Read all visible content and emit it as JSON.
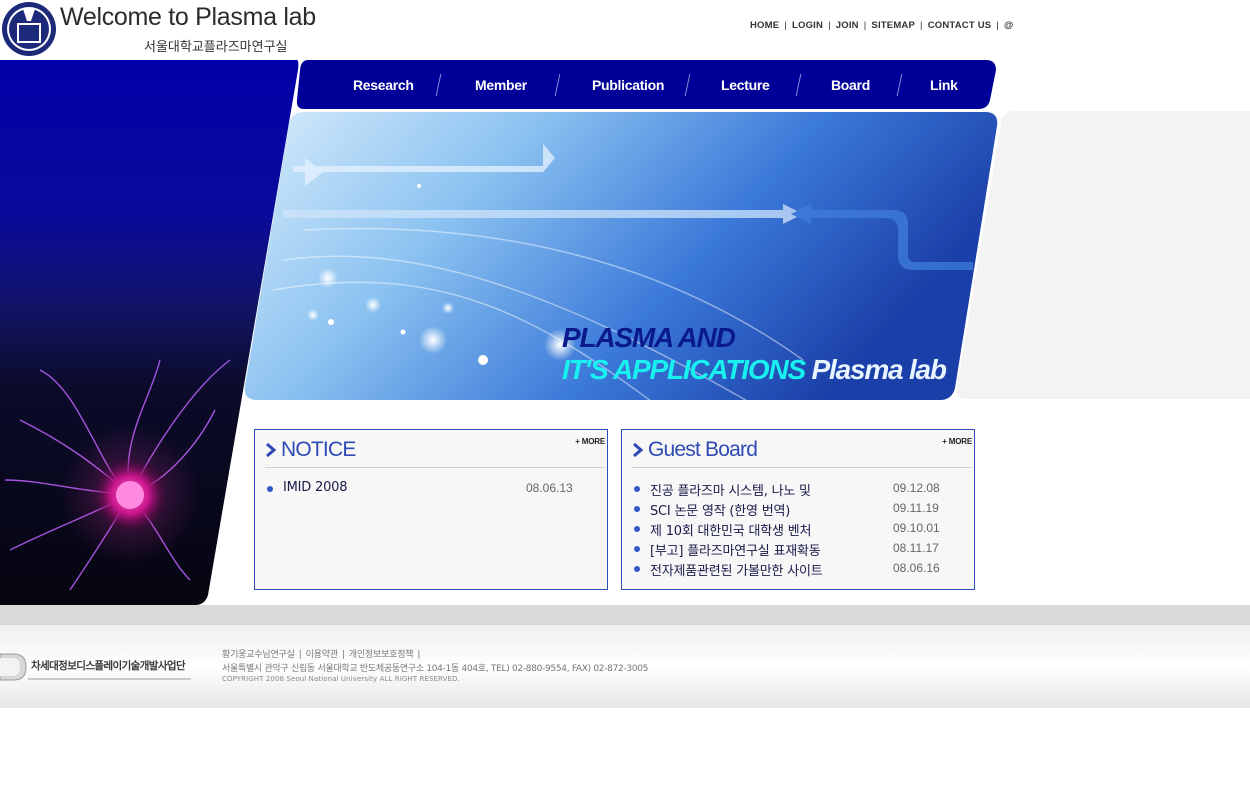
{
  "header": {
    "title": "Welcome to Plasma lab",
    "subtitle": "서울대학교플라즈마연구실",
    "emblem_text": "VERI TAS LUX MEA",
    "top_links": [
      "HOME",
      "LOGIN",
      "JOIN",
      "SITEMAP",
      "CONTACT US",
      "@"
    ]
  },
  "nav": {
    "items": [
      "Research",
      "Member",
      "Publication",
      "Lecture",
      "Board",
      "Link"
    ],
    "bar_color": "#000099"
  },
  "banner": {
    "line1": "PLASMA AND",
    "line2": "IT'S APPLICATIONS",
    "line2_suffix": "Plasma lab"
  },
  "notice": {
    "title": "NOTICE",
    "more_label": "MORE",
    "items": [
      {
        "title": "IMID 2008",
        "date": "08.06.13"
      }
    ]
  },
  "guestboard": {
    "title": "Guest Board",
    "more_label": "MORE",
    "items": [
      {
        "title": "진공 플라즈마 시스템, 나노 및",
        "date": "09.12.08"
      },
      {
        "title": "SCI 논문 영작 (한영 번역)",
        "date": "09.11.19"
      },
      {
        "title": "제 10회 대한민국 대학생 벤처",
        "date": "09.10.01"
      },
      {
        "title": "[부고] 플라즈마연구실 표재확동",
        "date": "08.11.17"
      },
      {
        "title": "전자제품관련된 가볼만한 사이트",
        "date": "08.06.16"
      }
    ]
  },
  "footer": {
    "org": "차세대정보디스플레이기술개발사업단",
    "links": [
      "황기웅교수님연구실",
      "이용약관",
      "개인정보보호정책"
    ],
    "address": "서울특별시 관악구 신림동 서울대학교 반도체공동연구소 104-1동 404호, TEL) 02-880-9554, FAX) 02-872-3005",
    "copyright": "COPYRIGHT 2008 Seoul National University ALL RIGHT RESERVED."
  },
  "colors": {
    "nav": "#000099",
    "box_border": "#2f4dbb",
    "box_title": "#2f49b5",
    "banner_cyan": "#19f0f0",
    "banner_navy": "#0a1a8c"
  }
}
